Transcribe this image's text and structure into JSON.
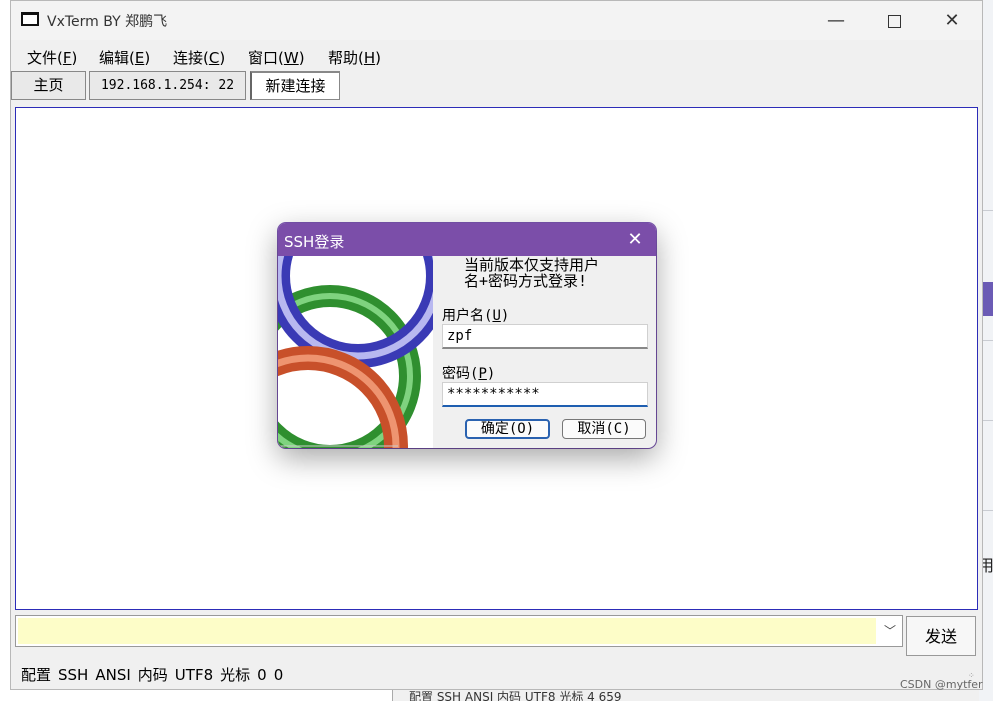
{
  "window": {
    "title": "VxTerm BY 郑鹏飞",
    "min_label": "—",
    "close_label": "✕"
  },
  "menu": {
    "items": [
      {
        "label": "文件(",
        "accel": "F",
        "tail": ")"
      },
      {
        "label": "编辑(",
        "accel": "E",
        "tail": ")"
      },
      {
        "label": "连接(",
        "accel": "C",
        "tail": ")"
      },
      {
        "label": "窗口(",
        "accel": "W",
        "tail": ")"
      },
      {
        "label": "帮助(",
        "accel": "H",
        "tail": ")"
      }
    ]
  },
  "tabs": [
    "主页",
    "192.168.1.254: 22",
    "新建连接"
  ],
  "input": {
    "value": ""
  },
  "send_label": "发送",
  "status": [
    "配置",
    "SSH",
    "ANSI",
    "内码",
    "UTF8",
    "光标",
    "0",
    "0"
  ],
  "background_status": "配置  SSH  ANSI  内码  UTF8  光标  4  659",
  "background_glyph": "用",
  "dialog": {
    "title": "SSH登录",
    "close_label": "✕",
    "message_line1": "当前版本仅支持用户",
    "message_line2": "名+密码方式登录!",
    "username_label": "用户名(",
    "username_accel": "U",
    "username_tail": ")",
    "username_value": "zpf",
    "password_label": "密码(",
    "password_accel": "P",
    "password_tail": ")",
    "password_value": "***********",
    "ok_label": "确定(O)",
    "cancel_label": "取消(C)"
  },
  "colors": {
    "dialog_title_bg": "#7b4ea9",
    "input_bg": "#fdfdc8",
    "terminal_border": "#2c2cb8"
  },
  "watermark": "CSDN @mytfer"
}
